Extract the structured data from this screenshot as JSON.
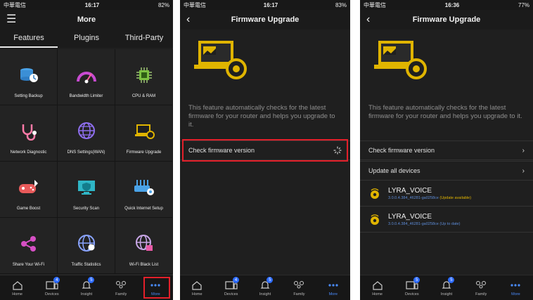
{
  "screens": [
    {
      "status": {
        "carrier": "中華電信",
        "time": "16:17",
        "battery": "82%"
      },
      "title": "More",
      "tabs": [
        "Features",
        "Plugins",
        "Third-Party"
      ],
      "features": [
        {
          "label": "Setting Backup",
          "icon": "setting-backup-icon"
        },
        {
          "label": "Bandwidth Limiter",
          "icon": "bandwidth-gauge-icon"
        },
        {
          "label": "CPU & RAM",
          "icon": "cpu-chip-icon"
        },
        {
          "label": "Network Diagnostic",
          "icon": "stethoscope-icon"
        },
        {
          "label": "DNS Settings(WAN)",
          "icon": "globe-icon"
        },
        {
          "label": "Firmware Upgrade",
          "icon": "firmware-laptop-icon"
        },
        {
          "label": "Game Boost",
          "icon": "gamepad-rocket-icon"
        },
        {
          "label": "Security Scan",
          "icon": "shield-monitor-icon"
        },
        {
          "label": "Quick Internet Setup",
          "icon": "router-gear-icon"
        },
        {
          "label": "Share Your Wi-Fi",
          "icon": "share-icon"
        },
        {
          "label": "Traffic Statistics",
          "icon": "traffic-globe-icon"
        },
        {
          "label": "Wi-Fi Black List",
          "icon": "globe-lock-icon"
        }
      ],
      "nav": [
        {
          "label": "Home",
          "badge": ""
        },
        {
          "label": "Devices",
          "badge": "4"
        },
        {
          "label": "Insight",
          "badge": "5"
        },
        {
          "label": "Family",
          "badge": ""
        },
        {
          "label": "More",
          "badge": ""
        }
      ]
    },
    {
      "status": {
        "carrier": "中華電信",
        "time": "16:17",
        "battery": "83%"
      },
      "title": "Firmware Upgrade",
      "description": "This feature automatically checks for the latest firmware for your router and helps you upgrade to it.",
      "check_row": "Check firmware version",
      "nav": [
        {
          "label": "Home",
          "badge": ""
        },
        {
          "label": "Devices",
          "badge": "4"
        },
        {
          "label": "Insight",
          "badge": "5"
        },
        {
          "label": "Family",
          "badge": ""
        },
        {
          "label": "More",
          "badge": ""
        }
      ]
    },
    {
      "status": {
        "carrier": "中華電信",
        "time": "16:36",
        "battery": "77%"
      },
      "title": "Firmware Upgrade",
      "description": "This feature automatically checks for the latest firmware for your router and helps you upgrade to it.",
      "check_row": "Check firmware version",
      "update_row": "Update all devices",
      "devices": [
        {
          "name": "LYRA_VOICE",
          "version": "3.0.0.4.384_46281-ga0258ce",
          "status": "(Update available)"
        },
        {
          "name": "LYRA_VOICE",
          "version": "3.0.0.4.384_46281-ga0258ce",
          "status": "(Up to date)"
        }
      ],
      "nav": [
        {
          "label": "Home",
          "badge": ""
        },
        {
          "label": "Devices",
          "badge": "5"
        },
        {
          "label": "Insight",
          "badge": "5"
        },
        {
          "label": "Family",
          "badge": ""
        },
        {
          "label": "More",
          "badge": ""
        }
      ]
    }
  ],
  "colors": {
    "highlight": "#e3202a",
    "accent": "#4a8cff",
    "gold": "#e0b400"
  }
}
